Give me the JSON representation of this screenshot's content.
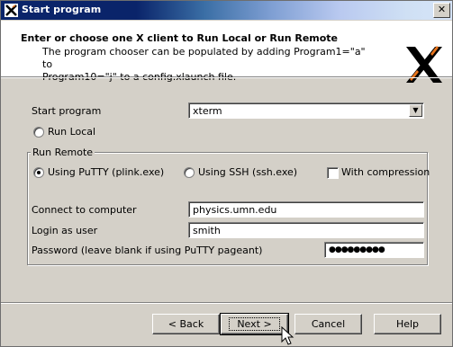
{
  "window": {
    "title": "Start program"
  },
  "header": {
    "title": "Enter or choose one X client to Run Local or Run Remote",
    "description_line1": "The program chooser can be populated by adding Program1=\"a\" to",
    "description_line2": "Program10=\"j\" to a config.xlaunch file."
  },
  "form": {
    "start_program_label": "Start program",
    "start_program_value": "xterm",
    "run_local_label": "Run Local",
    "run_remote_label": "Run Remote",
    "putty_label": "Using PuTTY (plink.exe)",
    "ssh_label": "Using SSH (ssh.exe)",
    "compression_label": "With compression",
    "connect_label": "Connect to computer",
    "connect_value": "physics.umn.edu",
    "login_label": "Login as user",
    "login_value": "smith",
    "password_label": "Password (leave blank if using PuTTY pageant)",
    "password_value": "●●●●●●●●●",
    "selected_mode": "Using PuTTY (plink.exe)",
    "compression_checked": false
  },
  "buttons": {
    "back": "< Back",
    "next": "Next >",
    "cancel": "Cancel",
    "help": "Help"
  }
}
